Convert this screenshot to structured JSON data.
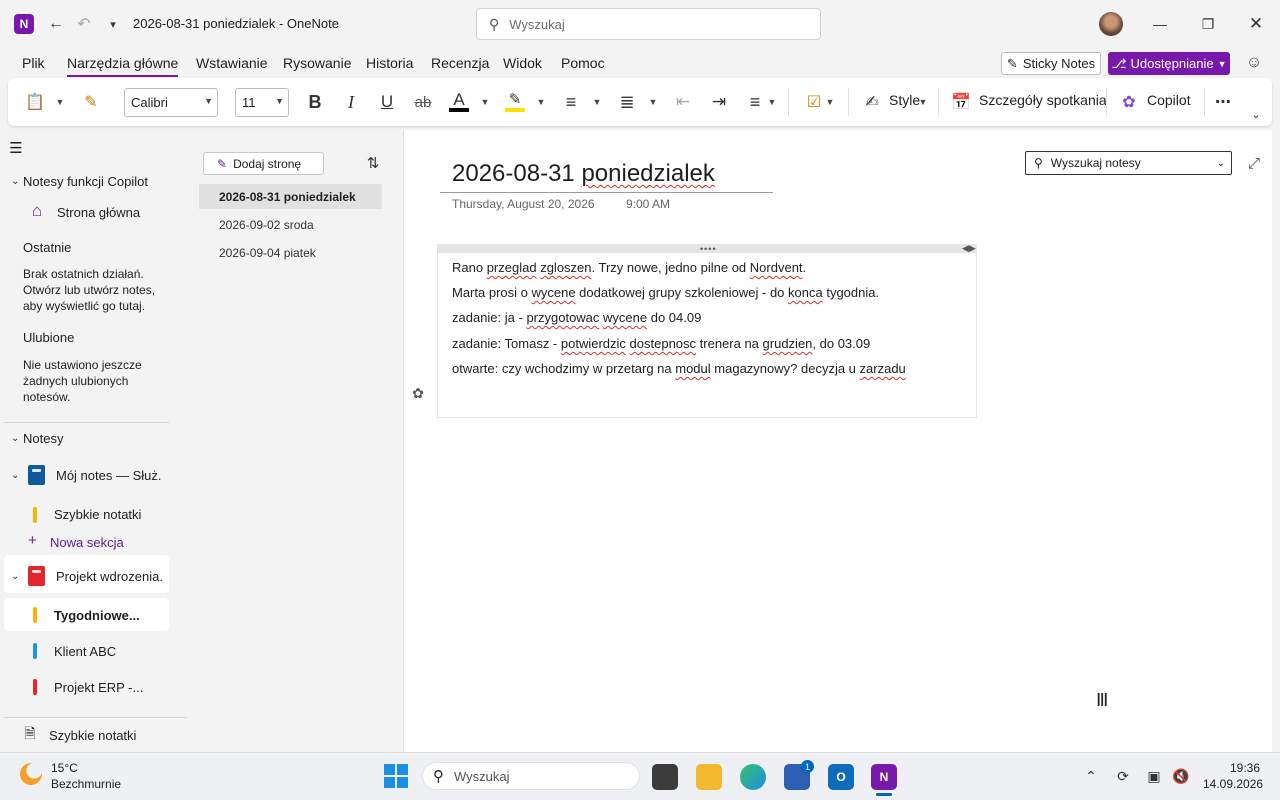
{
  "titlebar": {
    "doc_title": "2026-08-31 poniedzialek  -  OneNote",
    "search_placeholder": "Wyszukaj",
    "app_logo": "N"
  },
  "menu": {
    "items": [
      "Plik",
      "Narzędzia główne",
      "Wstawianie",
      "Rysowanie",
      "Historia",
      "Recenzja",
      "Widok",
      "Pomoc"
    ],
    "active": "Narzędzia główne",
    "sticky_notes": "Sticky Notes",
    "share": "Udostępnianie"
  },
  "ribbon": {
    "font_name": "Calibri",
    "font_size": "11",
    "style_label": "Style",
    "meeting_label": "Szczegóły spotkania",
    "copilot_label": "Copilot"
  },
  "nav": {
    "copilot_section": "Notesy funkcji Copilot",
    "home": "Strona główna",
    "recent_header": "Ostatnie",
    "recent_empty": "Brak ostatnich działań. Otwórz lub utwórz notes, aby wyświetlić go tutaj.",
    "favorites_header": "Ulubione",
    "favorites_empty": "Nie ustawiono jeszcze żadnych ulubionych notesów.",
    "notebooks_header": "Notesy",
    "notebook1": "Mój notes — Służ...",
    "notebook1_section": "Szybkie notatki",
    "new_section": "Nowa sekcja",
    "notebook2": "Projekt wdrozenia...",
    "sections": [
      {
        "label": "Tygodniowe...",
        "color": "#f7b500"
      },
      {
        "label": "Klient ABC",
        "color": "#1a9ad6"
      },
      {
        "label": "Projekt ERP -...",
        "color": "#e3262e"
      }
    ],
    "quick_notes": "Szybkie notatki"
  },
  "pages": {
    "add_page": "Dodaj stronę",
    "items": [
      "2026-08-31 poniedzialek",
      "2026-09-02 sroda",
      "2026-09-04 piatek"
    ]
  },
  "canvas": {
    "title": "2026-08-31 poniedzialek",
    "date": "Thursday, August 20, 2026",
    "time": "9:00 AM",
    "search_notebooks": "Wyszukaj notesy",
    "lines": [
      "Rano przeglad zgloszen. Trzy nowe, jedno pilne od Nordvent.",
      "Marta prosi o wycene dodatkowej grupy szkoleniowej - do konca tygodnia.",
      "zadanie: ja - przygotowac wycene do 04.09",
      "zadanie: Tomasz - potwierdzic dostepnosc trenera na grudzien, do 03.09",
      "otwarte: czy wchodzimy w przetarg na modul magazynowy? decyzja u zarzadu"
    ]
  },
  "taskbar": {
    "weather_temp": "15°C",
    "weather_desc": "Bezchmurnie",
    "search_placeholder": "Wyszukaj",
    "store_badge": "1",
    "time": "19:36",
    "date": "14.09.2026"
  },
  "colors": {
    "accent": "#7719aa",
    "spell_error": "#d13438"
  }
}
